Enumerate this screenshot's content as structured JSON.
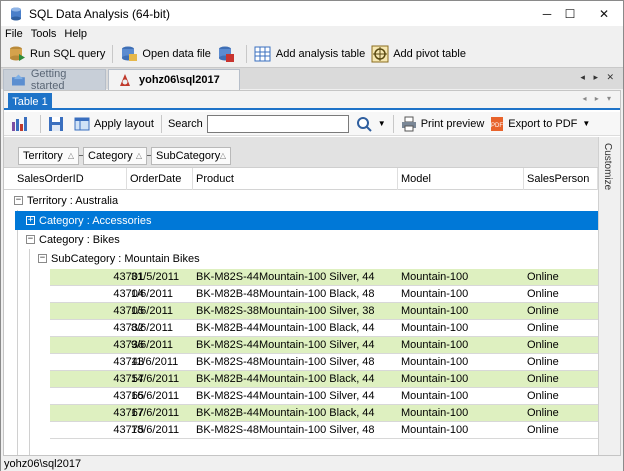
{
  "window": {
    "title": "SQL Data Analysis (64-bit)",
    "minimize": "─",
    "maximize": "☐",
    "close": "✕"
  },
  "menu": [
    "File",
    "Tools",
    "Help"
  ],
  "toolbar": {
    "run_sql": "Run SQL query",
    "open_data": "Open data file",
    "add_analysis": "Add analysis table",
    "add_pivot": "Add pivot table"
  },
  "doc_tabs": {
    "getting_started": "Getting started",
    "active": "yohz06\\sql2017",
    "nav": "◂ ▸ ✕"
  },
  "inner": {
    "tab": "Table 1",
    "nav": "◂ ▸ ▾",
    "apply_layout": "Apply layout",
    "search_label": "Search",
    "search_value": "",
    "print_preview": "Print preview",
    "export_pdf": "Export to PDF",
    "customize": "Customize"
  },
  "group_chips": [
    "Territory",
    "Category",
    "SubCategory"
  ],
  "columns": [
    "SalesOrderID",
    "OrderDate",
    "Product",
    "Model",
    "SalesPerson"
  ],
  "groups": {
    "territory": "Territory : Australia",
    "accessories": "Category : Accessories",
    "bikes": "Category : Bikes",
    "subcat": "SubCategory : Mountain Bikes"
  },
  "rows": [
    {
      "id": "43701",
      "date": "31/5/2011",
      "product": "BK-M82S-44Mountain-100 Silver, 44",
      "model": "Mountain-100",
      "sp": "Online"
    },
    {
      "id": "43704",
      "date": "1/6/2011",
      "product": "BK-M82B-48Mountain-100 Black, 48",
      "model": "Mountain-100",
      "sp": "Online"
    },
    {
      "id": "43705",
      "date": "1/6/2011",
      "product": "BK-M82S-38Mountain-100 Silver, 38",
      "model": "Mountain-100",
      "sp": "Online"
    },
    {
      "id": "43732",
      "date": "8/6/2011",
      "product": "BK-M82B-44Mountain-100 Black, 44",
      "model": "Mountain-100",
      "sp": "Online"
    },
    {
      "id": "43736",
      "date": "9/6/2011",
      "product": "BK-M82S-44Mountain-100 Silver, 44",
      "model": "Mountain-100",
      "sp": "Online"
    },
    {
      "id": "43743",
      "date": "11/6/2011",
      "product": "BK-M82S-48Mountain-100 Silver, 48",
      "model": "Mountain-100",
      "sp": "Online"
    },
    {
      "id": "43757",
      "date": "14/6/2011",
      "product": "BK-M82B-44Mountain-100 Black, 44",
      "model": "Mountain-100",
      "sp": "Online"
    },
    {
      "id": "43765",
      "date": "16/6/2011",
      "product": "BK-M82S-44Mountain-100 Silver, 44",
      "model": "Mountain-100",
      "sp": "Online"
    },
    {
      "id": "43767",
      "date": "17/6/2011",
      "product": "BK-M82B-44Mountain-100 Black, 44",
      "model": "Mountain-100",
      "sp": "Online"
    },
    {
      "id": "43775",
      "date": "18/6/2011",
      "product": "BK-M82S-48Mountain-100 Silver, 48",
      "model": "Mountain-100",
      "sp": "Online"
    }
  ],
  "status": "yohz06\\sql2017",
  "colors": {
    "accent": "#1e73c8",
    "row_alt": "#def0c0",
    "selected": "#0078d7"
  }
}
